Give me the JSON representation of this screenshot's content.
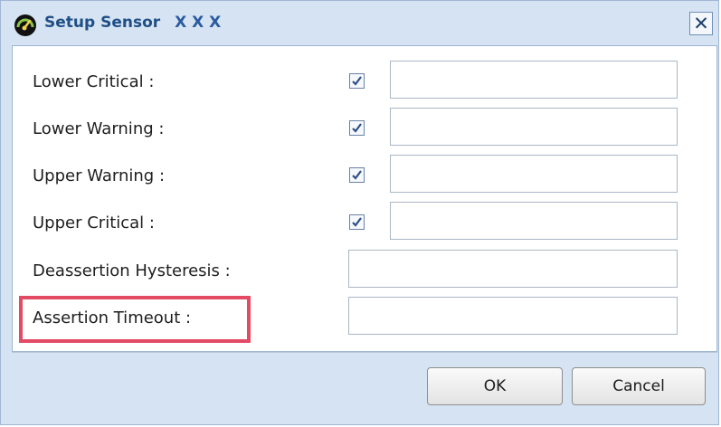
{
  "dialog": {
    "title": "Setup Sensor",
    "title_suffix": "X X X",
    "close_symbol": "✕",
    "icon": "gauge-icon"
  },
  "fields": [
    {
      "label": "Lower Critical :",
      "has_checkbox": true,
      "checked": true,
      "value": ""
    },
    {
      "label": "Lower Warning :",
      "has_checkbox": true,
      "checked": true,
      "value": ""
    },
    {
      "label": "Upper Warning :",
      "has_checkbox": true,
      "checked": true,
      "value": ""
    },
    {
      "label": "Upper Critical :",
      "has_checkbox": true,
      "checked": true,
      "value": ""
    },
    {
      "label": "Deassertion Hysteresis :",
      "has_checkbox": false,
      "value": ""
    },
    {
      "label": "Assertion Timeout :",
      "has_checkbox": false,
      "value": "",
      "highlighted": true
    }
  ],
  "buttons": {
    "ok": "OK",
    "cancel": "Cancel"
  },
  "colors": {
    "dialog_bg": "#d6e3f2",
    "title": "#1f4f86",
    "highlight": "#e24b63"
  }
}
